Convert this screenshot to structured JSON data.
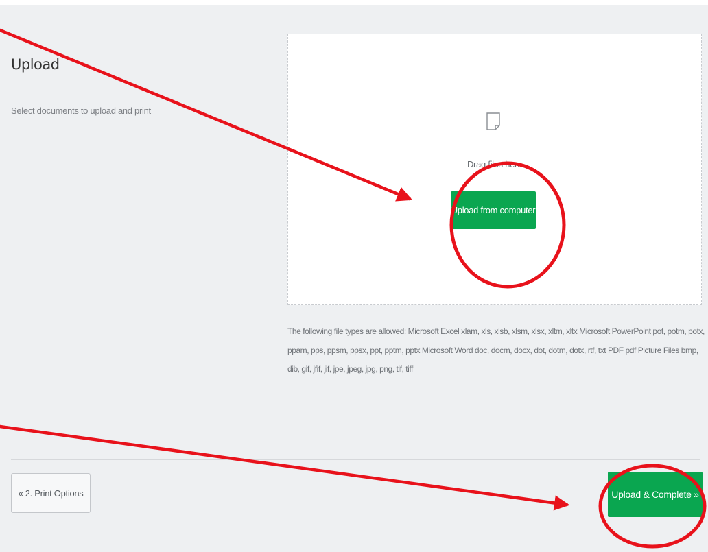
{
  "upload_section": {
    "title": "Upload",
    "subtitle": "Select documents to upload and print"
  },
  "dropzone": {
    "icon": "document-icon",
    "drag_text": "Drag files here",
    "upload_button_label": "Upload from computer"
  },
  "file_types_note": "The following file types are allowed: Microsoft Excel xlam, xls, xlsb, xlsm, xlsx, xltm, xltx Microsoft PowerPoint pot, potm, potx, ppam, pps, ppsm, ppsx, ppt, pptm, pptx Microsoft Word doc, docm, docx, dot, dotm, dotx, rtf, txt PDF pdf Picture Files bmp, dib, gif, jfif, jif, jpe, jpeg, jpg, png, tif, tiff",
  "footer": {
    "back_button_label": "« 2. Print Options",
    "complete_button_label": "Upload & Complete »"
  },
  "colors": {
    "accent_green": "#0aa650",
    "annotation_red": "#e8121b",
    "panel_background": "#eef0f2"
  }
}
